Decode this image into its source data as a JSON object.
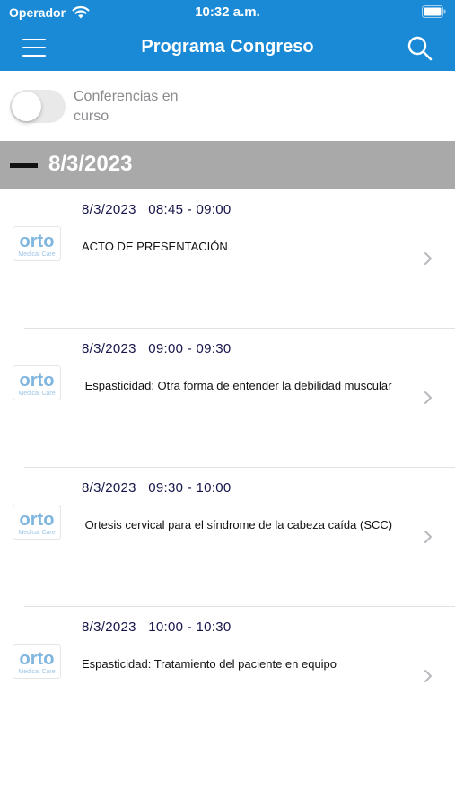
{
  "status_bar": {
    "carrier": "Operador",
    "time": "10:32 a.m."
  },
  "nav": {
    "title": "Programa Congreso"
  },
  "filter": {
    "label": "Conferencias en curso",
    "on": false
  },
  "section": {
    "date": "8/3/2023"
  },
  "logo": {
    "main": "orto",
    "sub": "Medical Care"
  },
  "colors": {
    "brand": "#1a8ad6",
    "section_bg": "#a9a9a9",
    "time_text": "#15154a"
  },
  "sessions": [
    {
      "time": "8/3/2023   08:45 - 09:00",
      "title": "ACTO DE PRESENTACIÓN"
    },
    {
      "time": "8/3/2023   09:00 - 09:30",
      "title": " Espasticidad: Otra forma de entender la debilidad muscular"
    },
    {
      "time": "8/3/2023   09:30 - 10:00",
      "title": " Ortesis cervical para el síndrome de la cabeza caída (SCC)"
    },
    {
      "time": "8/3/2023   10:00 - 10:30",
      "title": "Espasticidad: Tratamiento del paciente en equipo"
    }
  ]
}
